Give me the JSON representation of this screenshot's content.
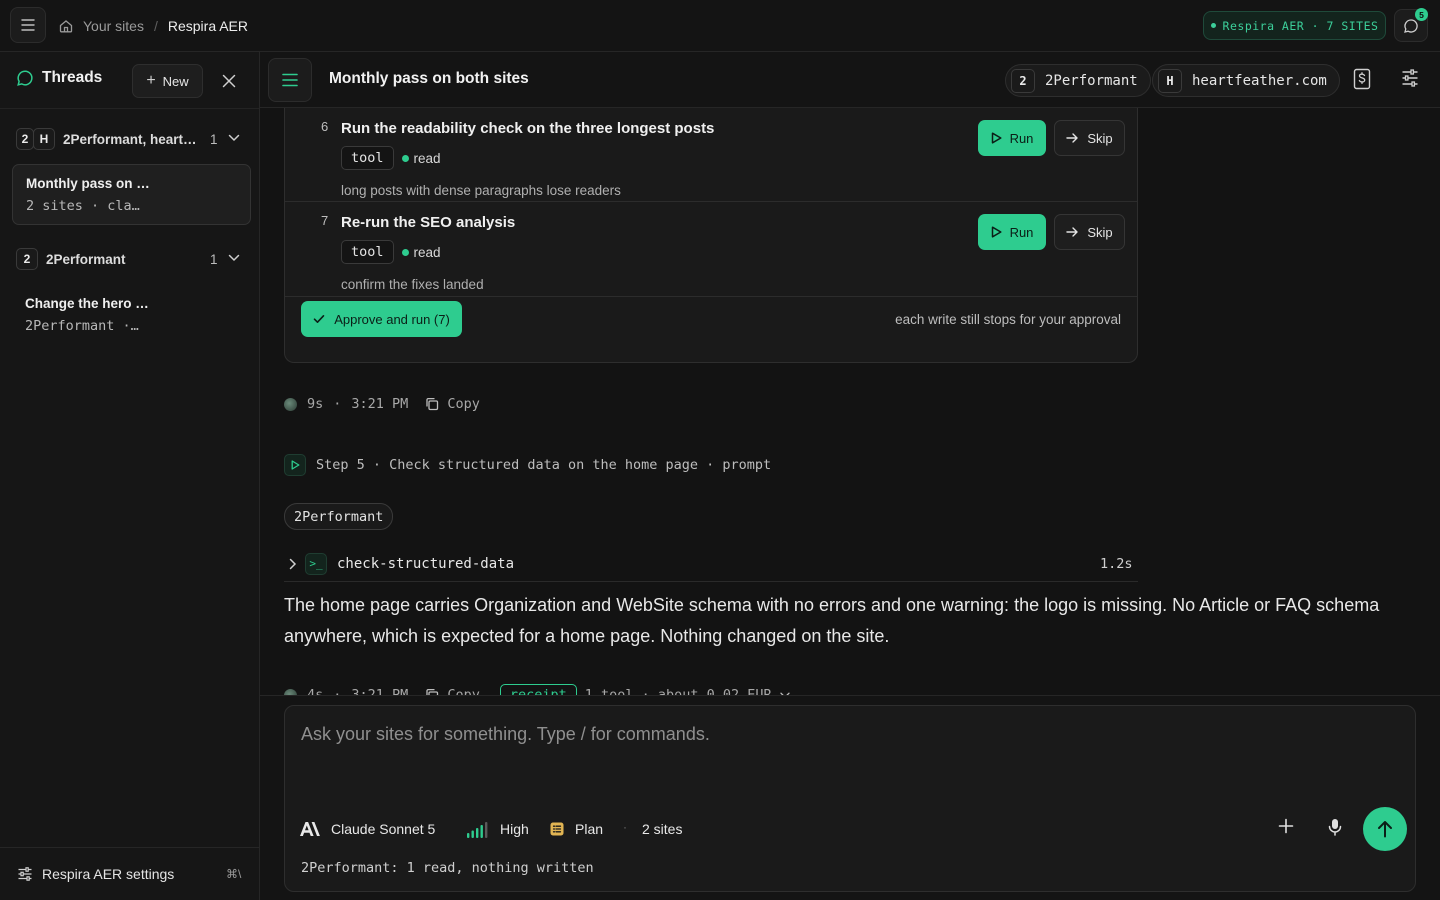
{
  "topbar": {
    "breadcrumb_root": "Your sites",
    "breadcrumb_sep": "/",
    "breadcrumb_current": "Respira AER",
    "status_pill": "Respira AER · 7 SITES",
    "notification_count": "5"
  },
  "sidebar": {
    "title": "Threads",
    "new_label": "New",
    "groups": [
      {
        "avatars": [
          "2",
          "H"
        ],
        "name": "2Performant, heart…",
        "count": "1",
        "threads": [
          {
            "title": "Monthly pass on …",
            "subtitle": "2 sites · cla…",
            "active": true
          }
        ]
      },
      {
        "avatars": [
          "2"
        ],
        "name": "2Performant",
        "count": "1",
        "threads": [
          {
            "title": "Change the hero …",
            "subtitle": "2Performant ·…",
            "active": false
          }
        ]
      }
    ],
    "settings_label": "Respira AER settings",
    "settings_shortcut": "⌘\\"
  },
  "header": {
    "title": "Monthly pass on both sites",
    "sites": [
      {
        "avatar": "2",
        "name": "2Performant"
      },
      {
        "avatar": "H",
        "name": "heartfeather.com"
      }
    ]
  },
  "plan": {
    "steps": [
      {
        "number": "6",
        "title": "Run the readability check on the three longest posts",
        "kind": "tool",
        "access": "read",
        "description": "long posts with dense paragraphs lose readers",
        "run_label": "Run",
        "skip_label": "Skip"
      },
      {
        "number": "7",
        "title": "Re-run the SEO analysis",
        "kind": "tool",
        "access": "read",
        "description": "confirm the fixes landed",
        "run_label": "Run",
        "skip_label": "Skip"
      }
    ],
    "approve_label": "Approve and run (7)",
    "approve_note": "each write still stops for your approval"
  },
  "message1_meta": {
    "duration": "9s",
    "time": "3:21 PM",
    "copy_label": "Copy"
  },
  "step5": {
    "label": "Step 5 · Check structured data on the home page · prompt",
    "site": "2Performant",
    "tool_name": "check-structured-data",
    "tool_duration": "1.2s",
    "answer": "The home page carries Organization and WebSite schema with no errors and one warning: the logo is missing. No Article or FAQ schema anywhere, which is expected for a home page. Nothing changed on the site."
  },
  "message2_meta": {
    "duration": "4s",
    "time": "3:21 PM",
    "copy_label": "Copy",
    "receipt_label": "receipt",
    "receipt_summary": "1 tool · about 0.02 EUR"
  },
  "composer": {
    "placeholder": "Ask your sites for something. Type / for commands.",
    "model": "Claude Sonnet 5",
    "effort": "High",
    "mode": "Plan",
    "sites": "2 sites",
    "footnote": "2Performant: 1 read, nothing written"
  },
  "colors": {
    "accent": "#2ecc8f",
    "background": "#131313",
    "panel": "#1a1a1a",
    "plan_icon": "#e2b553"
  }
}
